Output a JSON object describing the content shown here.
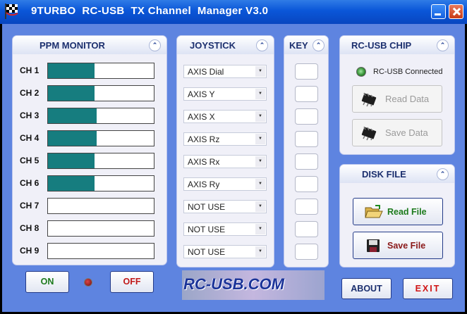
{
  "window": {
    "title": "9TURBO  RC-USB  TX Channel  Manager V3.0"
  },
  "ppm": {
    "heading": "PPM MONITOR",
    "channels": [
      {
        "label": "CH 1",
        "level": 0.44
      },
      {
        "label": "CH 2",
        "level": 0.44
      },
      {
        "label": "CH 3",
        "level": 0.46
      },
      {
        "label": "CH 4",
        "level": 0.46
      },
      {
        "label": "CH 5",
        "level": 0.44
      },
      {
        "label": "CH 6",
        "level": 0.44
      },
      {
        "label": "CH 7",
        "level": 0
      },
      {
        "label": "CH 8",
        "level": 0
      },
      {
        "label": "CH 9",
        "level": 0
      }
    ],
    "on_label": "ON",
    "off_label": "OFF"
  },
  "joystick": {
    "heading": "JOYSTICK",
    "assignments": [
      "AXIS Dial",
      "AXIS Y",
      "AXIS X",
      "AXIS Rz",
      "AXIS Rx",
      "AXIS Ry",
      "NOT USE",
      "NOT USE",
      "NOT USE"
    ]
  },
  "key": {
    "heading": "KEY"
  },
  "chip": {
    "heading": "RC-USB  CHIP",
    "status": "RC-USB Connected",
    "read_label": "Read Data",
    "save_label": "Save Data"
  },
  "disk": {
    "heading": "DISK FILE",
    "read_label": "Read File",
    "save_label": "Save File"
  },
  "logo": {
    "text": "RC-USB.COM"
  },
  "footer": {
    "about_label": "ABOUT",
    "exit_label": "EXIT"
  },
  "colors": {
    "accent": "#167d7f",
    "background": "#5e84e0",
    "title_bar": "#0a56d8"
  }
}
